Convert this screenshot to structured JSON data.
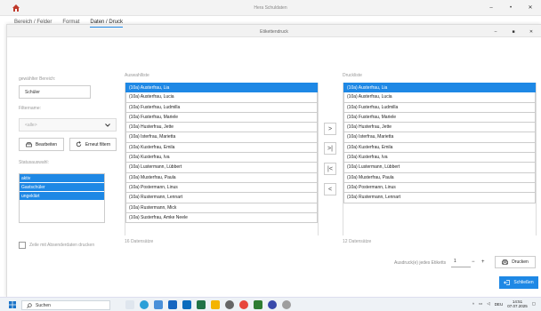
{
  "app": {
    "title": "Hera Schuldaten",
    "icon": "home-icon",
    "controls": [
      "‒",
      "•",
      "✕"
    ]
  },
  "dialog": {
    "title": "Etikettendruck",
    "controls": [
      "‒",
      "■",
      "✕"
    ]
  },
  "tabs": [
    {
      "label": "Bereich / Felder",
      "active": false
    },
    {
      "label": "Format",
      "active": false
    },
    {
      "label": "Daten / Druck",
      "active": true
    }
  ],
  "left": {
    "bereich_label": "gewählter Bereich:",
    "bereich_value": "Schüler",
    "filter_label": "Filtername:",
    "filter_value": "<alle>",
    "edit_button": "Bearbeiten",
    "refresh_button": "Erneut filtern",
    "status_label": "Statusauswahl:",
    "status_items": [
      "aktiv",
      "Gastschüler",
      "ungeklärt"
    ],
    "checkbox_label": "Zeile mit Absenderdaten drucken"
  },
  "selection": {
    "label": "Auswahlliste",
    "rows": [
      "(10a) Austerfrau, Lia",
      "(10a) Austerfrau, Lucia",
      "(10a) Fusterfrau, Ludmilla",
      "(10a) Fusterfrau, Mariele",
      "(10a) Husterfrau, Jette",
      "(10a) Isterfrau, Marietta",
      "(10a) Kusterfrau, Emila",
      "(10a) Kusterfrau, Iva",
      "(10a) Lustermann, Lübbert",
      "(10a) Musterfrau, Paula",
      "(10a) Postermann, Linus",
      "(10a) Rustermann, Lennart",
      "(10a) Rustermann, Mick",
      "(10a) Susterfrau, Amke Neele"
    ],
    "count": "16 Datensätze"
  },
  "print_list": {
    "label": "Druckliste",
    "rows": [
      "(10a) Austerfrau, Lia",
      "(10a) Austerfrau, Lucia",
      "(10a) Fusterfrau, Ludmilla",
      "(10a) Fusterfrau, Mariele",
      "(10a) Husterfrau, Jette",
      "(10a) Isterfrau, Marietta",
      "(10a) Kusterfrau, Emila",
      "(10a) Kusterfrau, Iva",
      "(10a) Lustermann, Lübbert",
      "(10a) Musterfrau, Paula",
      "(10a) Postermann, Linus",
      "(10a) Rustermann, Lennart"
    ],
    "count": "12 Datensätze"
  },
  "transfer": {
    "add_one": ">",
    "add_all": ">|",
    "remove_all": "|<",
    "remove_one": "<"
  },
  "print": {
    "copies_label": "Ausdruck(e) jedes Etiketts",
    "copies_value": "1",
    "minus": "−",
    "plus": "+",
    "print_button": "Drucken",
    "close_button": "Schließen"
  },
  "taskbar": {
    "search_placeholder": "Suchen",
    "lang": "DEU",
    "time": "14:51",
    "date": "07.07.2025"
  },
  "colors": {
    "accent": "#1e88e5"
  }
}
